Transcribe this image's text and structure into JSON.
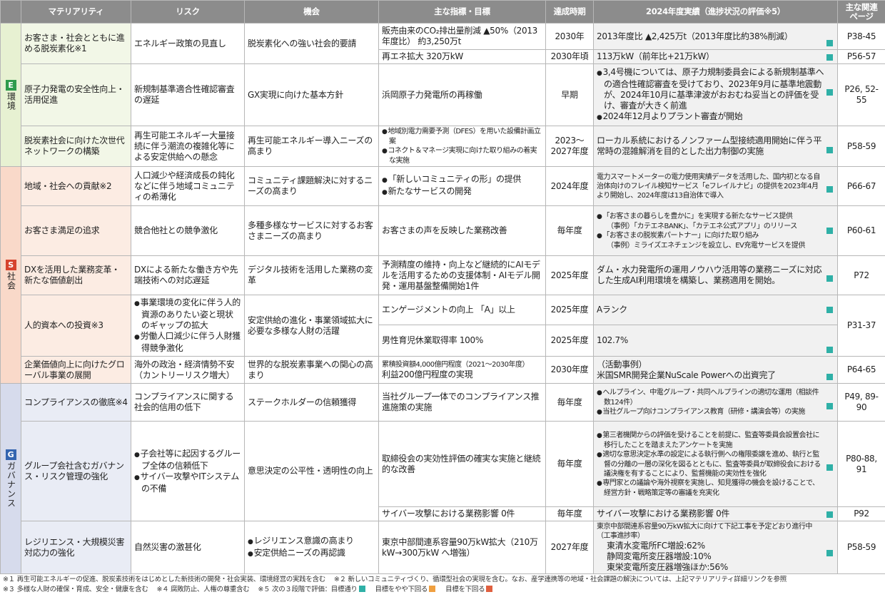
{
  "header": {
    "materiality": "マテリアリティ",
    "risk": "リスク",
    "opportunity": "機会",
    "kpi": "主な指標・目標",
    "period": "達成時期",
    "result": "2024年度実績（進捗状況の評価※5）",
    "page_line1": "主な関連",
    "page_line2": "ページ"
  },
  "categories": {
    "e": {
      "letter": "E",
      "label": "環境"
    },
    "s": {
      "letter": "S",
      "label": "社会"
    },
    "g": {
      "letter": "G",
      "label": "ガバナンス"
    }
  },
  "rows": {
    "e1": {
      "materiality": "お客さま・社会とともに進める脱炭素化※1",
      "risk": "エネルギー政策の見直し",
      "opportunity": "脱炭素化への強い社会的要請",
      "kpi_a": "販売由来のCO₂排出量削減 ▲50%（2013年度比） 約3,250万t",
      "period_a": "2030年",
      "result_a": "2013年度比 ▲2,425万t（2013年度比約38%削減）",
      "kpi_b": "再エネ拡大 320万kW",
      "period_b": "2030年頃",
      "result_b": "113万kW（前年比+21万kW）",
      "page_a": "P38-45",
      "page_b": "P56-57"
    },
    "e2": {
      "materiality": "原子力発電の安全性向上・活用促進",
      "risk": "新規制基準適合性確認審査の遅延",
      "opportunity": "GX実現に向けた基本方針",
      "kpi": "浜岡原子力発電所の再稼働",
      "period": "早期",
      "result_1": "3,4号機については、原子力規制委員会による新規制基準への適合性確認審査を受けており、2023年9月に基準地震動が、2024年10月に基準津波がおおむね妥当との評価を受け、審査が大きく前進",
      "result_2": "2024年12月よりプラント審査が開始",
      "page": "P26, 52-55"
    },
    "e3": {
      "materiality": "脱炭素社会に向けた次世代ネットワークの構築",
      "risk": "再生可能エネルギー大量接続に伴う潮流の複雑化等による安定供給への懸念",
      "opportunity": "再生可能エネルギー導入ニーズの高まり",
      "kpi_1": "地域別電力需要予測（DFES）を用いた設備計画立案",
      "kpi_2": "コネクト＆マネージ実現に向けた取り組みの着実な実施",
      "period": "2023〜2027年度",
      "result": "ローカル系統におけるノンファーム型接続適用開始に伴う平常時の混雑解消を目的とした出力制御の実施",
      "page": "P58-59"
    },
    "s1": {
      "materiality": "地域・社会への貢献※2",
      "risk": "人口減少や経済成長の鈍化などに伴う地域コミュニティの希薄化",
      "opportunity": "コミュニティ課題解決に対するニーズの高まり",
      "kpi_1": "「新しいコミュニティの形」の提供",
      "kpi_2": "新たなサービスの開発",
      "period": "2024年度",
      "result": "電力スマートメーターの電力使用実績データを活用した、国内初となる自治体向けのフレイル検知サービス「eフレイルナビ」の提供を2023年4月より開始し、2024年度は13自治体で導入",
      "page": "P66-67"
    },
    "s2": {
      "materiality": "お客さま満足の追求",
      "risk": "競合他社との競争激化",
      "opportunity": "多種多様なサービスに対するお客さまニーズの高まり",
      "kpi": "お客さまの声を反映した業務改善",
      "period": "毎年度",
      "result_1": "「お客さまの暮らしを豊かに」を実現する新たなサービス提供",
      "result_1b": "（事例）「カテエネBANK」、「カテエネ公式アプリ」のリリース",
      "result_2": "「お客さまの脱炭素パートナー」に向けた取り組み",
      "result_2b": "（事例）ミライズエネチェンジを設立し、EV充電サービスを提供",
      "page": "P60-61"
    },
    "s3": {
      "materiality": "DXを活用した業務変革・新たな価値創出",
      "risk": "DXによる新たな働き方や先端技術への対応遅延",
      "opportunity": "デジタル技術を活用した業務の変革",
      "kpi": "予測精度の維持・向上など継続的にAIモデルを活用するための支援体制・AIモデル開発・運用基盤整備開始1件",
      "period": "2025年度",
      "result": "ダム・水力発電所の運用ノウハウ活用等の業務ニーズに対応した生成AI利用環境を構築し、業務適用を開始。",
      "page": "P72"
    },
    "s4": {
      "materiality": "人的資本への投資※3",
      "risk_1": "事業環境の変化に伴う人的資源のありたい姿と現状のギャップの拡大",
      "risk_2": "労働人口減少に伴う人財獲得競争激化",
      "opportunity": "安定供給の進化・事業領域拡大に必要な多様な人財の活躍",
      "kpi_a": "エンゲージメントの向上 「A」以上",
      "period_a": "2025年度",
      "result_a": "Aランク",
      "kpi_b": "男性育児休業取得率 100%",
      "period_b": "2025年度",
      "result_b": "102.7%",
      "page": "P31-37"
    },
    "s5": {
      "materiality": "企業価値向上に向けたグローバル事業の展開",
      "risk": "海外の政治・経済情勢不安（カントリーリスク増大）",
      "opportunity": "世界的な脱炭素事業への関心の高まり",
      "kpi_1": "累積投資額4,000億円程度（2021〜2030年度）",
      "kpi_2": "利益200億円程度の実現",
      "period": "2030年度",
      "result_1": "（活動事例）",
      "result_2": "米国SMR開発企業NuScale Powerへの出資完了",
      "page": "P64-65"
    },
    "g1": {
      "materiality": "コンプライアンスの徹底※4",
      "risk": "コンプライアンスに関する社会的信用の低下",
      "opportunity": "ステークホルダーの信頼獲得",
      "kpi": "当社グループ一体でのコンプライアンス推進施策の実施",
      "period": "毎年度",
      "result_1": "ヘルプライン、中電グループ・共同ヘルプラインの適切な運用（相談件数124件）",
      "result_2": "当社グループ向けコンプライアンス教育（研修・講演会等）の実施",
      "page": "P49, 89-90"
    },
    "g2": {
      "materiality": "グループ会社含むガバナンス・リスク管理の強化",
      "risk_1": "子会社等に起因するグループ全体の信頼低下",
      "risk_2": "サイバー攻撃やITシステムの不備",
      "opportunity": "意思決定の公平性・透明性の向上",
      "kpi_a": "取締役会の実効性評価の確実な実施と継続的な改善",
      "period_a": "毎年度",
      "result_a1": "第三者機関からの評価を受けることを前提に、監査等委員会設置会社に移行したことを踏まえたアンケートを実施",
      "result_a2": "適切な意思決定水準の設定による執行側への権限委譲を進め、執行と監督の分離の一層の深化を図るとともに、監査等委員が取締役会における議決権を有することにより、監督機能の実効性を強化",
      "result_a3": "専門家との議論や海外視察を実施し、知見獲得の機会を設けることで、経営方針・戦略策定等の審議を充実化",
      "page_a": "P80-88, 91",
      "kpi_b": "サイバー攻撃における業務影響 0件",
      "period_b": "毎年度",
      "result_b": "サイバー攻撃における業務影響 0件",
      "page_b": "P92"
    },
    "g3": {
      "materiality": "レジリエンス・大規模災害対応力の強化",
      "risk": "自然災害の激甚化",
      "opportunity_1": "レジリエンス意識の高まり",
      "opportunity_2": "安定供給ニーズの再認識",
      "kpi": "東京中部間連系容量90万kW拡大（210万kW→300万kW へ増強）",
      "period": "2027年度",
      "result_head": "東京中部間連系容量90万kW拡大に向けて下記工事を予定どおり進行中（工事進捗率）",
      "result_1": "東清水変電所FC増設:62%",
      "result_2": "静岡変電所変圧器増設:10%",
      "result_3": "東栄変電所変圧器増強ほか:56%",
      "page": "P58-59"
    }
  },
  "notes": {
    "n1": "※１ 再生可能エネルギーの促進、脱炭素技術をはじめとした新技術の開発・社会実装、環境経営の実践を含む",
    "n2": "※２ 新しいコミュニティづくり、循環型社会の実現を含む。なお、産学連携等の地域・社会課題の解決については、上記マテリアリティ詳細リンクを参照",
    "n3": "※３ 多様な人財の確保・育成、安全・健康を含む",
    "n4": "※４ 腐敗防止、人権の尊重含む",
    "n5": "※５ 次の３段階で評価：目標通り",
    "n5b": "目標をやや下回る",
    "n5c": "目標を下回る"
  },
  "colors": {
    "header": "#8c8c8c",
    "env": "#2f9b4c",
    "soc": "#d6432e",
    "gov": "#3465b0",
    "achieved": "#2fb0a7",
    "slightly_below": "#f0a040",
    "below": "#e06040"
  }
}
